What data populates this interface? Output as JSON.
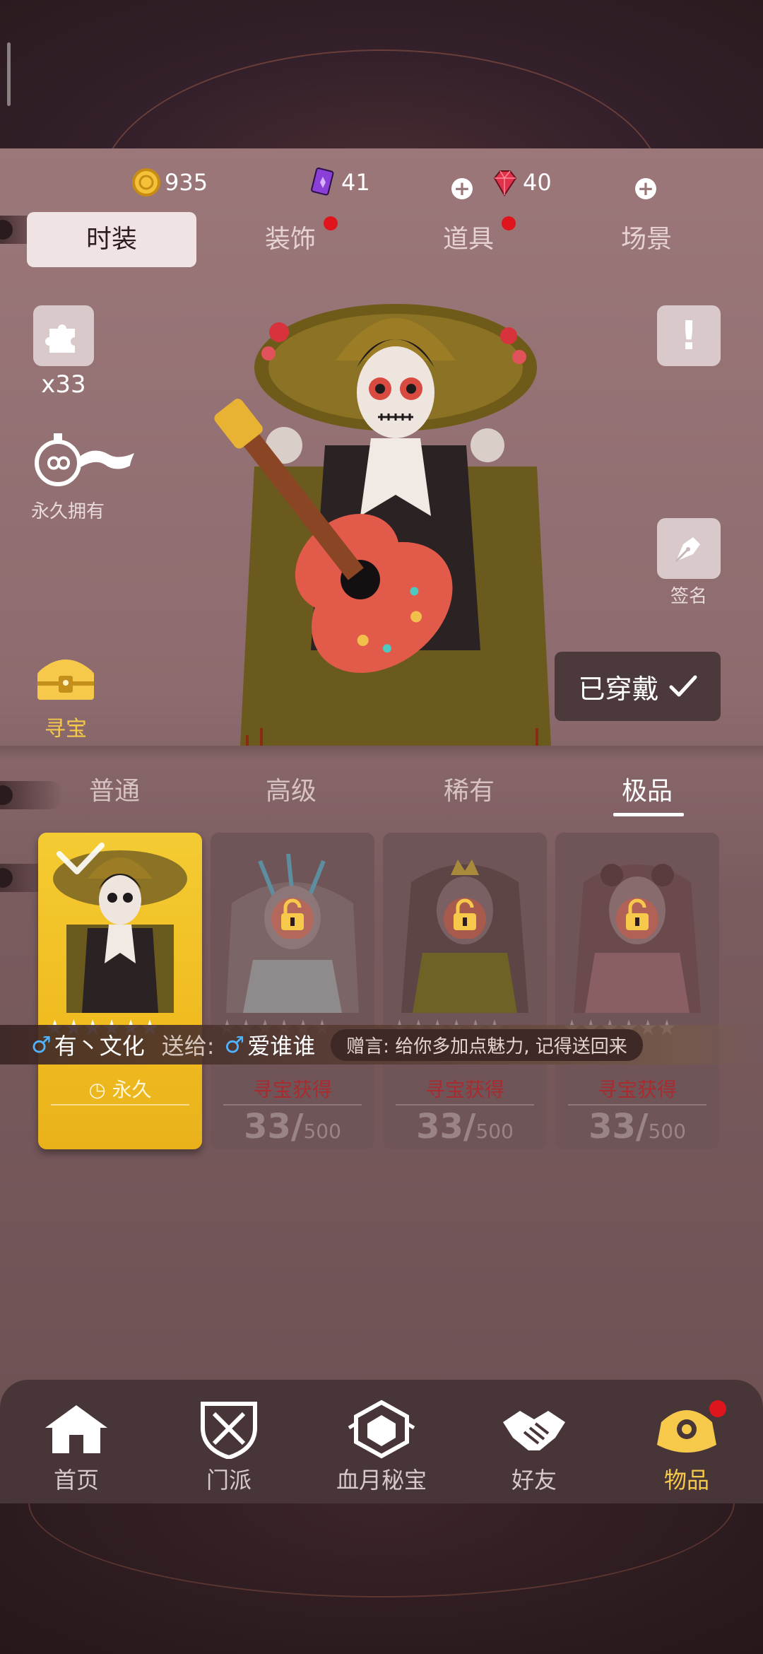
{
  "currency": {
    "gold": "935",
    "cards": "41",
    "gems": "40"
  },
  "categories": [
    {
      "label": "时装",
      "active": true,
      "dot": false
    },
    {
      "label": "装饰",
      "active": false,
      "dot": true
    },
    {
      "label": "道具",
      "active": false,
      "dot": true
    },
    {
      "label": "场景",
      "active": false,
      "dot": false
    }
  ],
  "tools": {
    "puzzle_count": "x33",
    "permanent_label": "永久拥有",
    "treasure_label": "寻宝",
    "sign_label": "签名",
    "info_symbol": "!"
  },
  "worn_button": "已穿戴",
  "rarity_tabs": [
    "普通",
    "高级",
    "稀有",
    "极品"
  ],
  "cards": [
    {
      "owned": true,
      "stars": "★★★★★★",
      "footer": "永久"
    },
    {
      "owned": false,
      "stars": "★★★★★★",
      "source": "寻宝获得",
      "count": "33/",
      "max": "500"
    },
    {
      "owned": false,
      "stars": "★★★★★★",
      "source": "寻宝获得",
      "count": "33/",
      "max": "500"
    },
    {
      "owned": false,
      "stars": "★★★★★★",
      "source": "寻宝获得",
      "count": "33/",
      "max": "500"
    }
  ],
  "gift": {
    "male_symbol": "♂",
    "sender": "有丶文化",
    "send_label": "送给:",
    "receiver": "爱谁谁",
    "message": "赠言: 给你多加点魅力, 记得送回来"
  },
  "nav": [
    {
      "label": "首页",
      "icon": "home-icon",
      "active": false
    },
    {
      "label": "门派",
      "icon": "shield-icon",
      "active": false
    },
    {
      "label": "血月秘宝",
      "icon": "hexagon-crest-icon",
      "active": false
    },
    {
      "label": "好友",
      "icon": "handshake-icon",
      "active": false
    },
    {
      "label": "物品",
      "icon": "bag-icon",
      "active": true
    }
  ],
  "colors": {
    "accent_gold": "#f6c94a",
    "badge_red": "#e0141c",
    "panel": "#9b7779"
  }
}
